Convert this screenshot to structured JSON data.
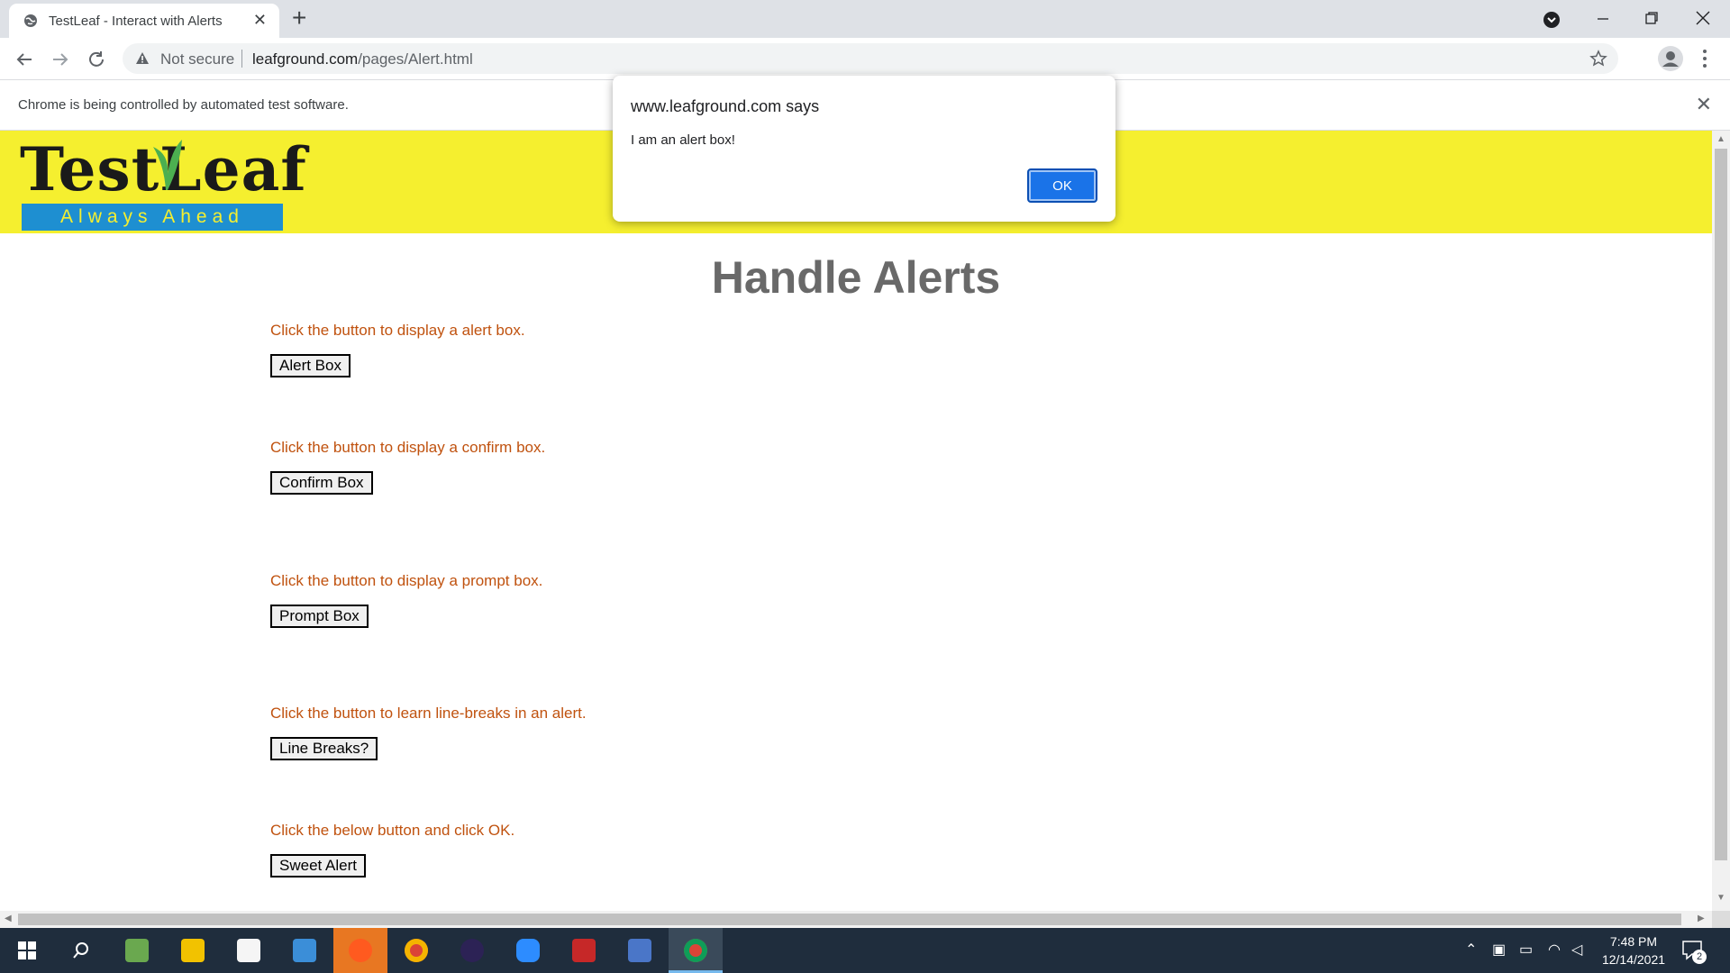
{
  "browser": {
    "tab_title": "TestLeaf - Interact with Alerts",
    "new_tab": "+",
    "tab_close": "✕",
    "security_label": "Not secure",
    "url_host": "leafground.com",
    "url_path": "/pages/Alert.html",
    "infobar_message": "Chrome is being controlled by automated test software.",
    "infobar_close": "✕"
  },
  "page": {
    "logo_text": "TestLeaf",
    "logo_tagline": "Always Ahead",
    "title": "Handle Alerts",
    "sections": [
      {
        "label": "Click the button to display a alert box.",
        "button": "Alert Box"
      },
      {
        "label": "Click the button to display a confirm box.",
        "button": "Confirm Box"
      },
      {
        "label": "Click the button to display a prompt box.",
        "button": "Prompt Box"
      },
      {
        "label": "Click the button to learn line-breaks in an alert.",
        "button": "Line Breaks?"
      },
      {
        "label": "Click the below button and click OK.",
        "button": "Sweet Alert"
      }
    ]
  },
  "dialog": {
    "heading": "www.leafground.com says",
    "message": "I am an alert box!",
    "ok_label": "OK"
  },
  "taskbar": {
    "time": "7:48 PM",
    "date": "12/14/2021",
    "notification_count": "2"
  },
  "colors": {
    "banner": "#f5ef2f",
    "label_text": "#c0520f",
    "dialog_ok": "#1a73e8",
    "taskbar": "#1f2d3d"
  }
}
